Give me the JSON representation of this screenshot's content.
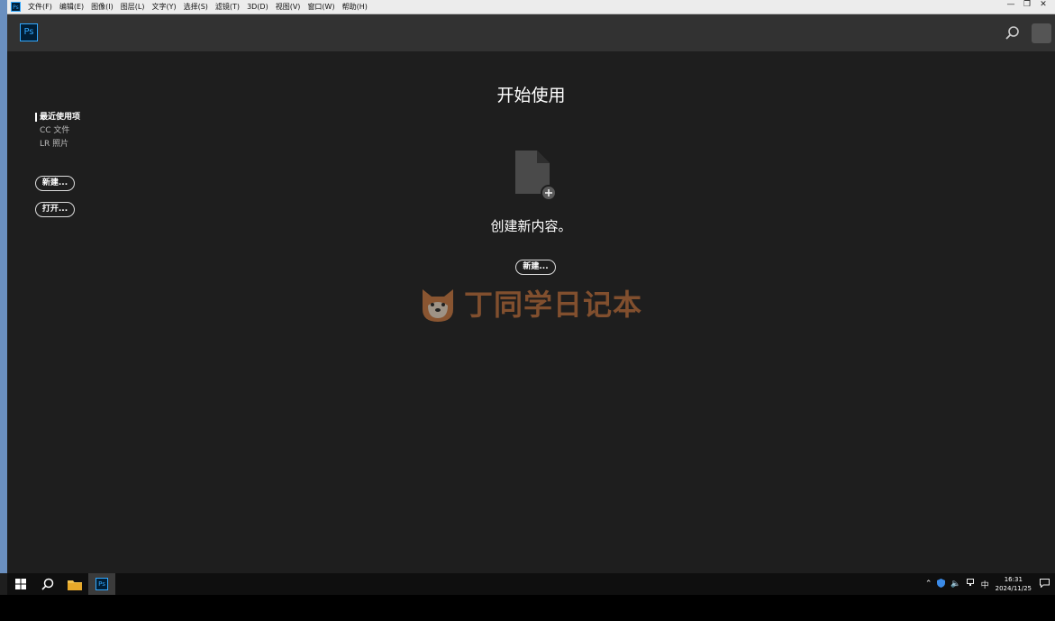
{
  "menubar": {
    "app_icon": "Ps",
    "items": [
      "文件(F)",
      "编辑(E)",
      "图像(I)",
      "图层(L)",
      "文字(Y)",
      "选择(S)",
      "滤镜(T)",
      "3D(D)",
      "视图(V)",
      "窗口(W)",
      "帮助(H)"
    ]
  },
  "header": {
    "logo": "Ps"
  },
  "sidebar": {
    "links": [
      "最近使用项",
      "CC 文件",
      "LR 照片"
    ],
    "new_button": "新建...",
    "open_button": "打开..."
  },
  "main": {
    "title": "开始使用",
    "create_text": "创建新内容。",
    "new_button": "新建..."
  },
  "watermark": {
    "text": "丁同学日记本"
  },
  "taskbar": {
    "ps_icon": "Ps",
    "ime": "中",
    "time": "16:31",
    "date": "2024/11/25"
  },
  "colors": {
    "accent": "#31a8ff",
    "background": "#1e1e1e",
    "header": "#323232"
  }
}
